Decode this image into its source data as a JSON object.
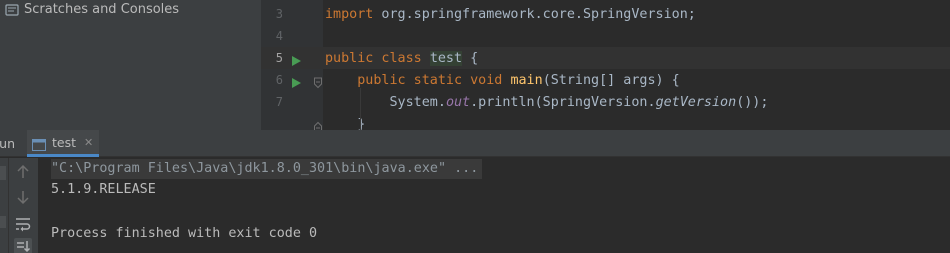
{
  "project": {
    "scratches_label": "Scratches and Consoles"
  },
  "editor": {
    "lines": [
      {
        "num": "3",
        "code": "import org.springframework.core.SpringVersion;"
      },
      {
        "num": "4",
        "code": ""
      },
      {
        "num": "5",
        "code": "public class test {"
      },
      {
        "num": "6",
        "code": "    public static void main(String[] args) {"
      },
      {
        "num": "7",
        "code": "        System.out.println(SpringVersion.getVersion());"
      },
      {
        "num": "",
        "code": "    }"
      }
    ],
    "current_line": "5"
  },
  "run_window": {
    "label": "Run:",
    "tab_label": "test",
    "tab_close": "✕",
    "toolbar_icons": [
      "arrow-up-icon",
      "arrow-down-icon",
      "soft-wrap-icon",
      "scroll-to-end-icon"
    ]
  },
  "console": {
    "command": "\"C:\\Program Files\\Java\\jdk1.8.0_301\\bin\\java.exe\" ...",
    "output": "5.1.9.RELEASE",
    "blank": "",
    "exit_message": "Process finished with exit code 0"
  },
  "colors": {
    "keyword": "#cc7832",
    "method": "#ffc66d",
    "static_field": "#9876aa",
    "text": "#a9b7c6",
    "run_icon": "#499c54",
    "tab_underline": "#4a88c7"
  }
}
